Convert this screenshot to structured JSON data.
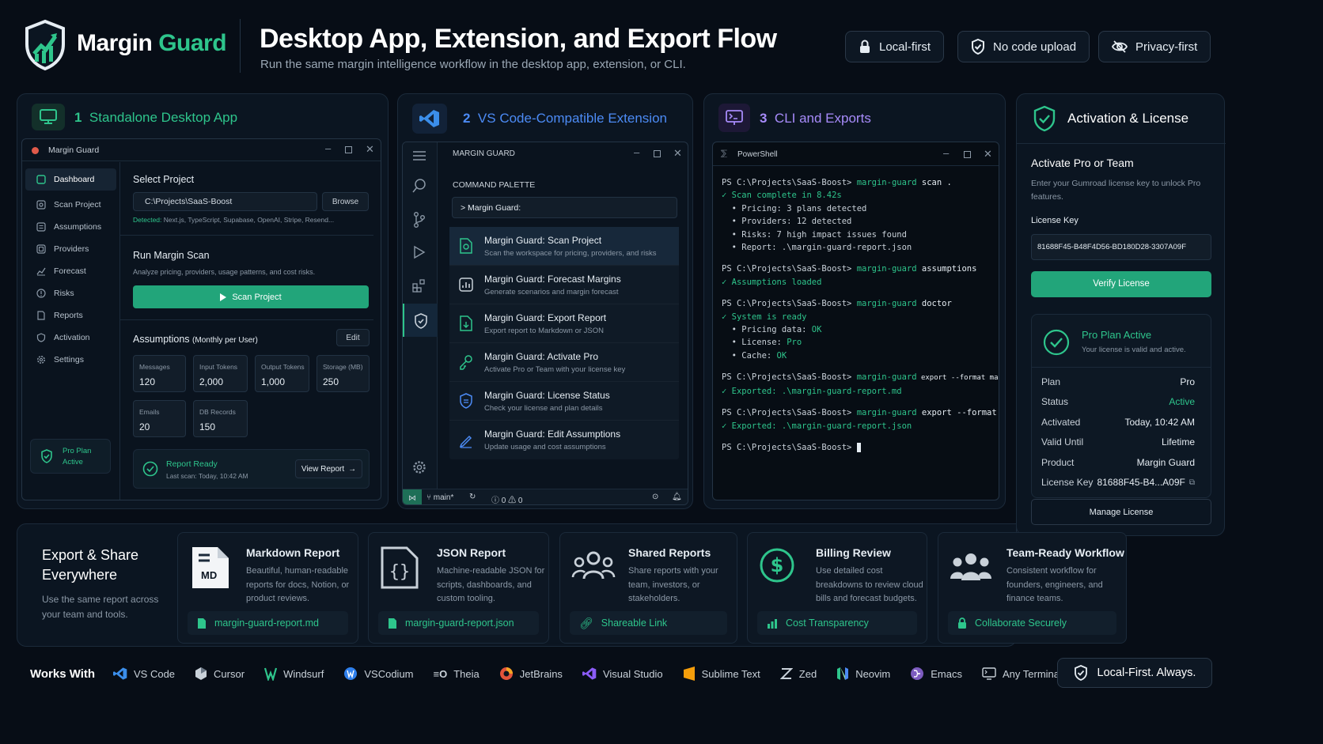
{
  "brand": {
    "name_a": "Margin",
    "name_b": "Guard"
  },
  "header": {
    "title": "Desktop App, Extension, and Export Flow",
    "subtitle": "Run the same margin intelligence workflow in the desktop app, extension, or CLI."
  },
  "badges": [
    "Local-first",
    "No code upload",
    "Privacy-first"
  ],
  "colors": {
    "accent": "#2ec58c",
    "blue": "#4c8bf5",
    "purple": "#a78bfa",
    "bg": "#070d16"
  },
  "desktop": {
    "section_num": "1",
    "section_title": "Standalone Desktop App",
    "window_title": "Margin Guard",
    "nav": [
      "Dashboard",
      "Scan Project",
      "Assumptions",
      "Providers",
      "Forecast",
      "Risks",
      "Reports",
      "Activation",
      "Settings"
    ],
    "select_label": "Select Project",
    "path": "C:\\Projects\\SaaS-Boost",
    "browse": "Browse",
    "detected_label": "Detected:",
    "detected": "Next.js, TypeScript, Supabase, OpenAI, Stripe, Resend...",
    "scan_title": "Run Margin Scan",
    "scan_desc": "Analyze pricing, providers, usage patterns, and cost risks.",
    "scan_button": "Scan Project",
    "assump_title": "Assumptions",
    "assump_sub": "(Monthly per User)",
    "edit": "Edit",
    "fields": [
      {
        "label": "Messages",
        "value": "120"
      },
      {
        "label": "Input Tokens",
        "value": "2,000"
      },
      {
        "label": "Output Tokens",
        "value": "1,000"
      },
      {
        "label": "Storage (MB)",
        "value": "250"
      },
      {
        "label": "Emails",
        "value": "20"
      },
      {
        "label": "DB Records",
        "value": "150"
      }
    ],
    "plan_a": "Pro Plan",
    "plan_b": "Active",
    "report_ready": "Report Ready",
    "last_scan": "Last scan: Today, 10:42 AM",
    "view_report": "View Report"
  },
  "ext": {
    "section_num": "2",
    "section_title": "VS Code-Compatible Extension",
    "window_title": "MARGIN GUARD",
    "palette_label": "COMMAND PALETTE",
    "input": "> Margin Guard:",
    "commands": [
      {
        "title": "Margin Guard: Scan Project",
        "desc": "Scan the workspace for pricing, providers, and risks"
      },
      {
        "title": "Margin Guard: Forecast Margins",
        "desc": "Generate scenarios and margin forecast"
      },
      {
        "title": "Margin Guard: Export Report",
        "desc": "Export report to Markdown or JSON"
      },
      {
        "title": "Margin Guard: Activate Pro",
        "desc": "Activate Pro or Team with your license key"
      },
      {
        "title": "Margin Guard: License Status",
        "desc": "Check your license and plan details"
      },
      {
        "title": "Margin Guard: Edit Assumptions",
        "desc": "Update usage and cost assumptions"
      }
    ],
    "status_branch": "main*",
    "status_err": "0",
    "status_warn": "0"
  },
  "cli": {
    "section_num": "3",
    "section_title": "CLI and Exports",
    "window_title": "PowerShell",
    "lines": [
      {
        "p": "PS C:\\Projects\\SaaS-Boost> ",
        "c": "margin-guard",
        "a": " scan ."
      },
      {
        "ok": "✓ Scan complete in 8.42s"
      },
      {
        "t": "  • Pricing: ",
        "v": "3 plans detected"
      },
      {
        "t": "  • Providers: ",
        "v": "12 detected"
      },
      {
        "t": "  • Risks: ",
        "v": "7 high impact issues found"
      },
      {
        "t": "  • Report: .\\margin-guard-report.json"
      },
      {
        "b": ""
      },
      {
        "p": "PS C:\\Projects\\SaaS-Boost> ",
        "c": "margin-guard",
        "a": " assumptions"
      },
      {
        "ok": "✓ Assumptions loaded"
      },
      {
        "b": ""
      },
      {
        "p": "PS C:\\Projects\\SaaS-Boost> ",
        "c": "margin-guard",
        "a": " doctor"
      },
      {
        "ok": "✓ System is ready"
      },
      {
        "t": "  • Pricing data: ",
        "g": "OK"
      },
      {
        "t": "  • License: ",
        "g": "Pro"
      },
      {
        "t": "  • Cache: ",
        "g": "OK"
      },
      {
        "b": ""
      },
      {
        "p": "PS C:\\Projects\\SaaS-Boost> ",
        "c": "margin-guard",
        "a": " export --format markdown"
      },
      {
        "ok": "✓ Exported: .\\margin-guard-report.md"
      },
      {
        "b": ""
      },
      {
        "p": "PS C:\\Projects\\SaaS-Boost> ",
        "c": "margin-guard",
        "a": " export --format json"
      },
      {
        "ok": "✓ Exported: .\\margin-guard-report.json"
      },
      {
        "b": ""
      },
      {
        "p": "PS C:\\Projects\\SaaS-Boost> ",
        "cursor": true
      }
    ]
  },
  "license": {
    "title": "Activation & License",
    "heading": "Activate Pro or Team",
    "desc": "Enter your Gumroad license key to unlock Pro features.",
    "key_label": "License Key",
    "key_value": "81688F45-B48F4D56-BD180D28-3307A09F",
    "verify": "Verify License",
    "active_title": "Pro Plan Active",
    "active_desc": "Your license is valid and active.",
    "rows": [
      {
        "k": "Plan",
        "v": "Pro"
      },
      {
        "k": "Status",
        "v": "Active"
      },
      {
        "k": "Activated",
        "v": "Today, 10:42 AM"
      },
      {
        "k": "Valid Until",
        "v": "Lifetime"
      },
      {
        "k": "Product",
        "v": "Margin Guard"
      },
      {
        "k": "License Key",
        "v": "81688F45-B4...A09F"
      }
    ],
    "manage": "Manage License"
  },
  "export": {
    "title": "Export & Share Everywhere",
    "desc": "Use the same report across your team and tools.",
    "cards": [
      {
        "title": "Markdown Report",
        "desc": "Beautiful, human-readable reports for docs, Notion, or product reviews.",
        "foot": "margin-guard-report.md",
        "icon": "md-file-icon",
        "badge": "MD"
      },
      {
        "title": "JSON Report",
        "desc": "Machine-readable JSON for scripts, dashboards, and custom tooling.",
        "foot": "margin-guard-report.json",
        "icon": "json-file-icon"
      },
      {
        "title": "Shared Reports",
        "desc": "Share reports with your team, investors, or stakeholders.",
        "foot": "Shareable Link",
        "icon": "people-icon"
      },
      {
        "title": "Billing Review",
        "desc": "Use detailed cost breakdowns to review cloud bills and forecast budgets.",
        "foot": "Cost Transparency",
        "icon": "dollar-icon"
      },
      {
        "title": "Team-Ready Workflow",
        "desc": "Consistent workflow for founders, engineers, and finance teams.",
        "foot": "Collaborate Securely",
        "icon": "team-icon"
      }
    ]
  },
  "works": {
    "label": "Works With",
    "items": [
      "VS Code",
      "Cursor",
      "Windsurf",
      "VSCodium",
      "Theia",
      "JetBrains",
      "Visual Studio",
      "Sublime Text",
      "Zed",
      "Neovim",
      "Emacs",
      "Any Terminal"
    ],
    "tagline": "Local-First. Always."
  }
}
